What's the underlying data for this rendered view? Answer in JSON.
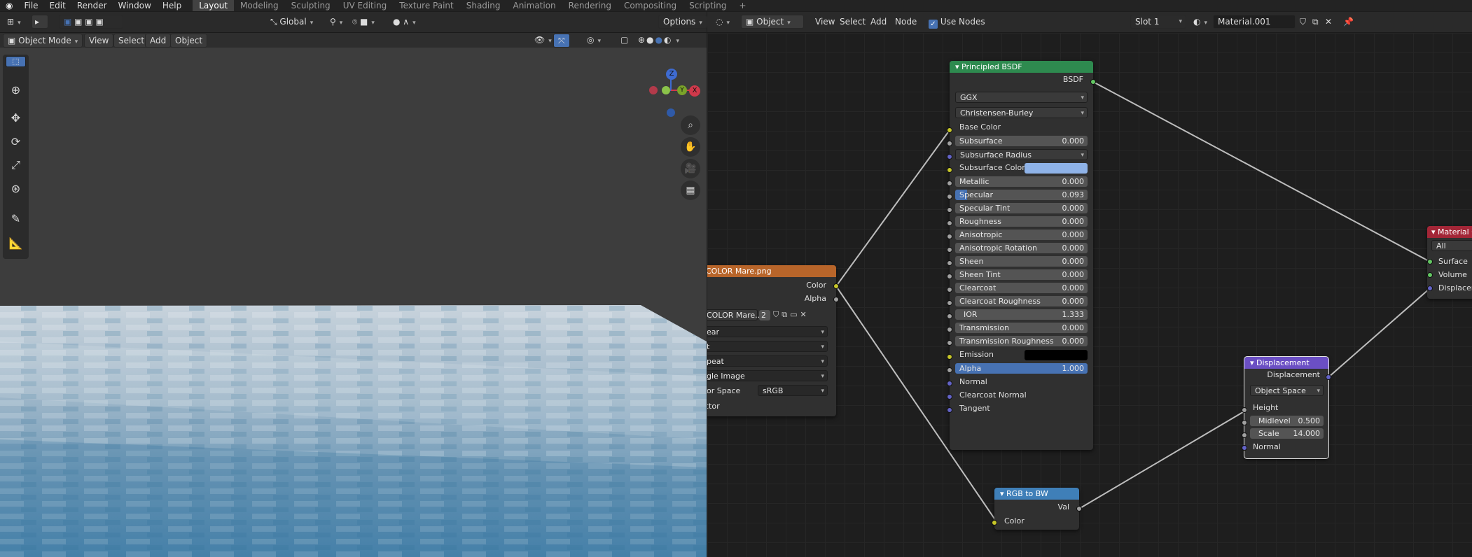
{
  "menus": [
    "File",
    "Edit",
    "Render",
    "Window",
    "Help"
  ],
  "workspaces": [
    "Layout",
    "Modeling",
    "Sculpting",
    "UV Editing",
    "Texture Paint",
    "Shading",
    "Animation",
    "Rendering",
    "Compositing",
    "Scripting",
    "+"
  ],
  "viewport": {
    "orientation": "Global",
    "options": "Options",
    "mode": "Object Mode",
    "menu": [
      "View",
      "Select",
      "Add",
      "Object"
    ]
  },
  "node_editor": {
    "type": "Object",
    "menu": [
      "View",
      "Select",
      "Add",
      "Node"
    ],
    "use_nodes": "Use Nodes",
    "slot": "Slot 1",
    "material": "Material.001"
  },
  "nodes": {
    "image": {
      "title": "COLOR Mare.png",
      "out": [
        "Color",
        "Alpha"
      ],
      "image_name": "COLOR Mare...",
      "users": "2",
      "options": [
        "ear",
        "t",
        "peat",
        "gle Image"
      ],
      "color_space_label": "lor Space",
      "color_space": "sRGB",
      "vector": "ctor"
    },
    "bsdf": {
      "title": "Principled BSDF",
      "output": "BSDF",
      "distribution": "GGX",
      "subsurface_method": "Christensen-Burley",
      "inputs": [
        {
          "label": "Base Color",
          "value": ""
        },
        {
          "label": "Subsurface",
          "value": "0.000"
        },
        {
          "label": "Subsurface Radius",
          "value": ""
        },
        {
          "label": "Subsurface Color",
          "value": ""
        },
        {
          "label": "Metallic",
          "value": "0.000"
        },
        {
          "label": "Specular",
          "value": "0.093"
        },
        {
          "label": "Specular Tint",
          "value": "0.000"
        },
        {
          "label": "Roughness",
          "value": "0.000"
        },
        {
          "label": "Anisotropic",
          "value": "0.000"
        },
        {
          "label": "Anisotropic Rotation",
          "value": "0.000"
        },
        {
          "label": "Sheen",
          "value": "0.000"
        },
        {
          "label": "Sheen Tint",
          "value": "0.000"
        },
        {
          "label": "Clearcoat",
          "value": "0.000"
        },
        {
          "label": "Clearcoat Roughness",
          "value": "0.000"
        },
        {
          "label": "IOR",
          "value": "1.333"
        },
        {
          "label": "Transmission",
          "value": "0.000"
        },
        {
          "label": "Transmission Roughness",
          "value": "0.000"
        },
        {
          "label": "Emission",
          "value": ""
        },
        {
          "label": "Alpha",
          "value": "1.000"
        },
        {
          "label": "Normal",
          "value": ""
        },
        {
          "label": "Clearcoat Normal",
          "value": ""
        },
        {
          "label": "Tangent",
          "value": ""
        }
      ]
    },
    "output": {
      "title": "Material O",
      "target": "All",
      "inputs": [
        "Surface",
        "Volume",
        "Displaceme"
      ]
    },
    "displacement": {
      "title": "Displacement",
      "output": "Displacement",
      "space": "Object Space",
      "height": "Height",
      "midlevel_label": "Midlevel",
      "midlevel": "0.500",
      "scale_label": "Scale",
      "scale": "14.000",
      "normal": "Normal"
    },
    "rgb2bw": {
      "title": "RGB to BW",
      "output": "Val",
      "input": "Color"
    }
  },
  "gizmo": {
    "z": "Z",
    "x": "X",
    "y": "Y"
  },
  "colors": {
    "accent": "#4772b3",
    "bsdf_header": "#2e8a4f",
    "image_header": "#b8652a",
    "output_header": "#a32637",
    "disp_header": "#6b4fc4",
    "rgb_header": "#3f7fb8",
    "subsurface_color": "#8fb3e8"
  }
}
